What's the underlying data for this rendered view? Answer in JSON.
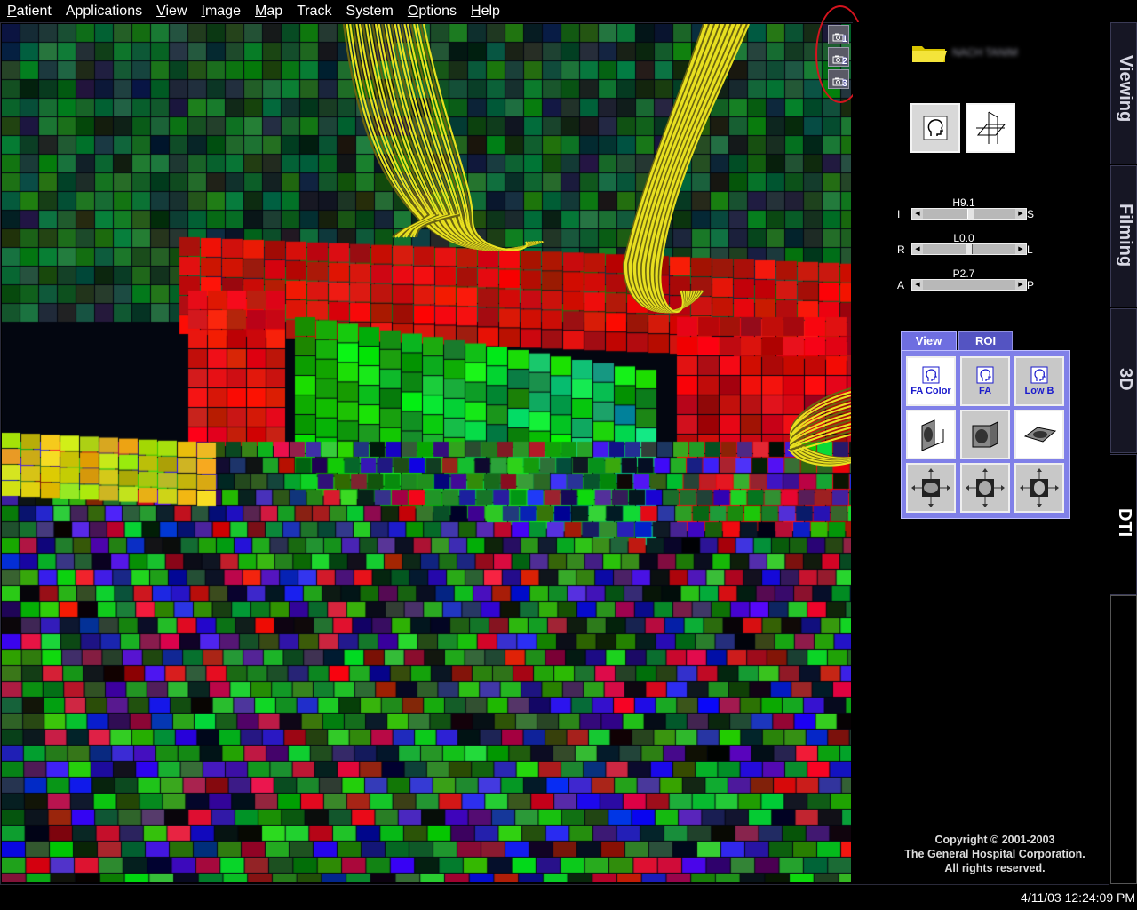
{
  "menu": {
    "items": [
      {
        "label_u": "P",
        "label_rest": "atient"
      },
      {
        "label_u": "",
        "label_rest": "Applications"
      },
      {
        "label_u": "V",
        "label_rest": "iew"
      },
      {
        "label_u": "I",
        "label_rest": "mage"
      },
      {
        "label_u": "M",
        "label_rest": "ap"
      },
      {
        "label_u": "",
        "label_rest": "Track"
      },
      {
        "label_u": "",
        "label_rest": "System"
      },
      {
        "label_u": "O",
        "label_rest": "ptions"
      },
      {
        "label_u": "H",
        "label_rest": "elp"
      }
    ]
  },
  "snapshots": [
    "1",
    "2",
    "3"
  ],
  "patient": {
    "name": "NACH TANIM"
  },
  "sliders": {
    "is": {
      "value": "H9.1",
      "left": "I",
      "right": "S",
      "level": 0.52
    },
    "rl": {
      "value": "L0.0",
      "left": "R",
      "right": "L",
      "level": 0.5
    },
    "ap": {
      "value": "P2.7",
      "left": "A",
      "right": "P",
      "level": null
    }
  },
  "dti_panel": {
    "tabs": {
      "view": "View",
      "roi": "ROI"
    },
    "modes": {
      "fa_color": "FA Color",
      "fa": "FA",
      "low_b": "Low B"
    }
  },
  "side_tabs": {
    "viewing": "Viewing",
    "filming": "Filming",
    "threed": "3D",
    "dti": "DTI"
  },
  "copyright": {
    "line1": "Copyright © 2001-2003",
    "line2": "The General Hospital Corporation.",
    "line3": "All rights reserved."
  },
  "status": {
    "datetime": "4/11/03 12:24:09 PM"
  },
  "colors": {
    "accent": "#8080e8",
    "tab_active": "#6e6ee0",
    "fiber": "#e8e020",
    "annotation": "#d4141e"
  }
}
